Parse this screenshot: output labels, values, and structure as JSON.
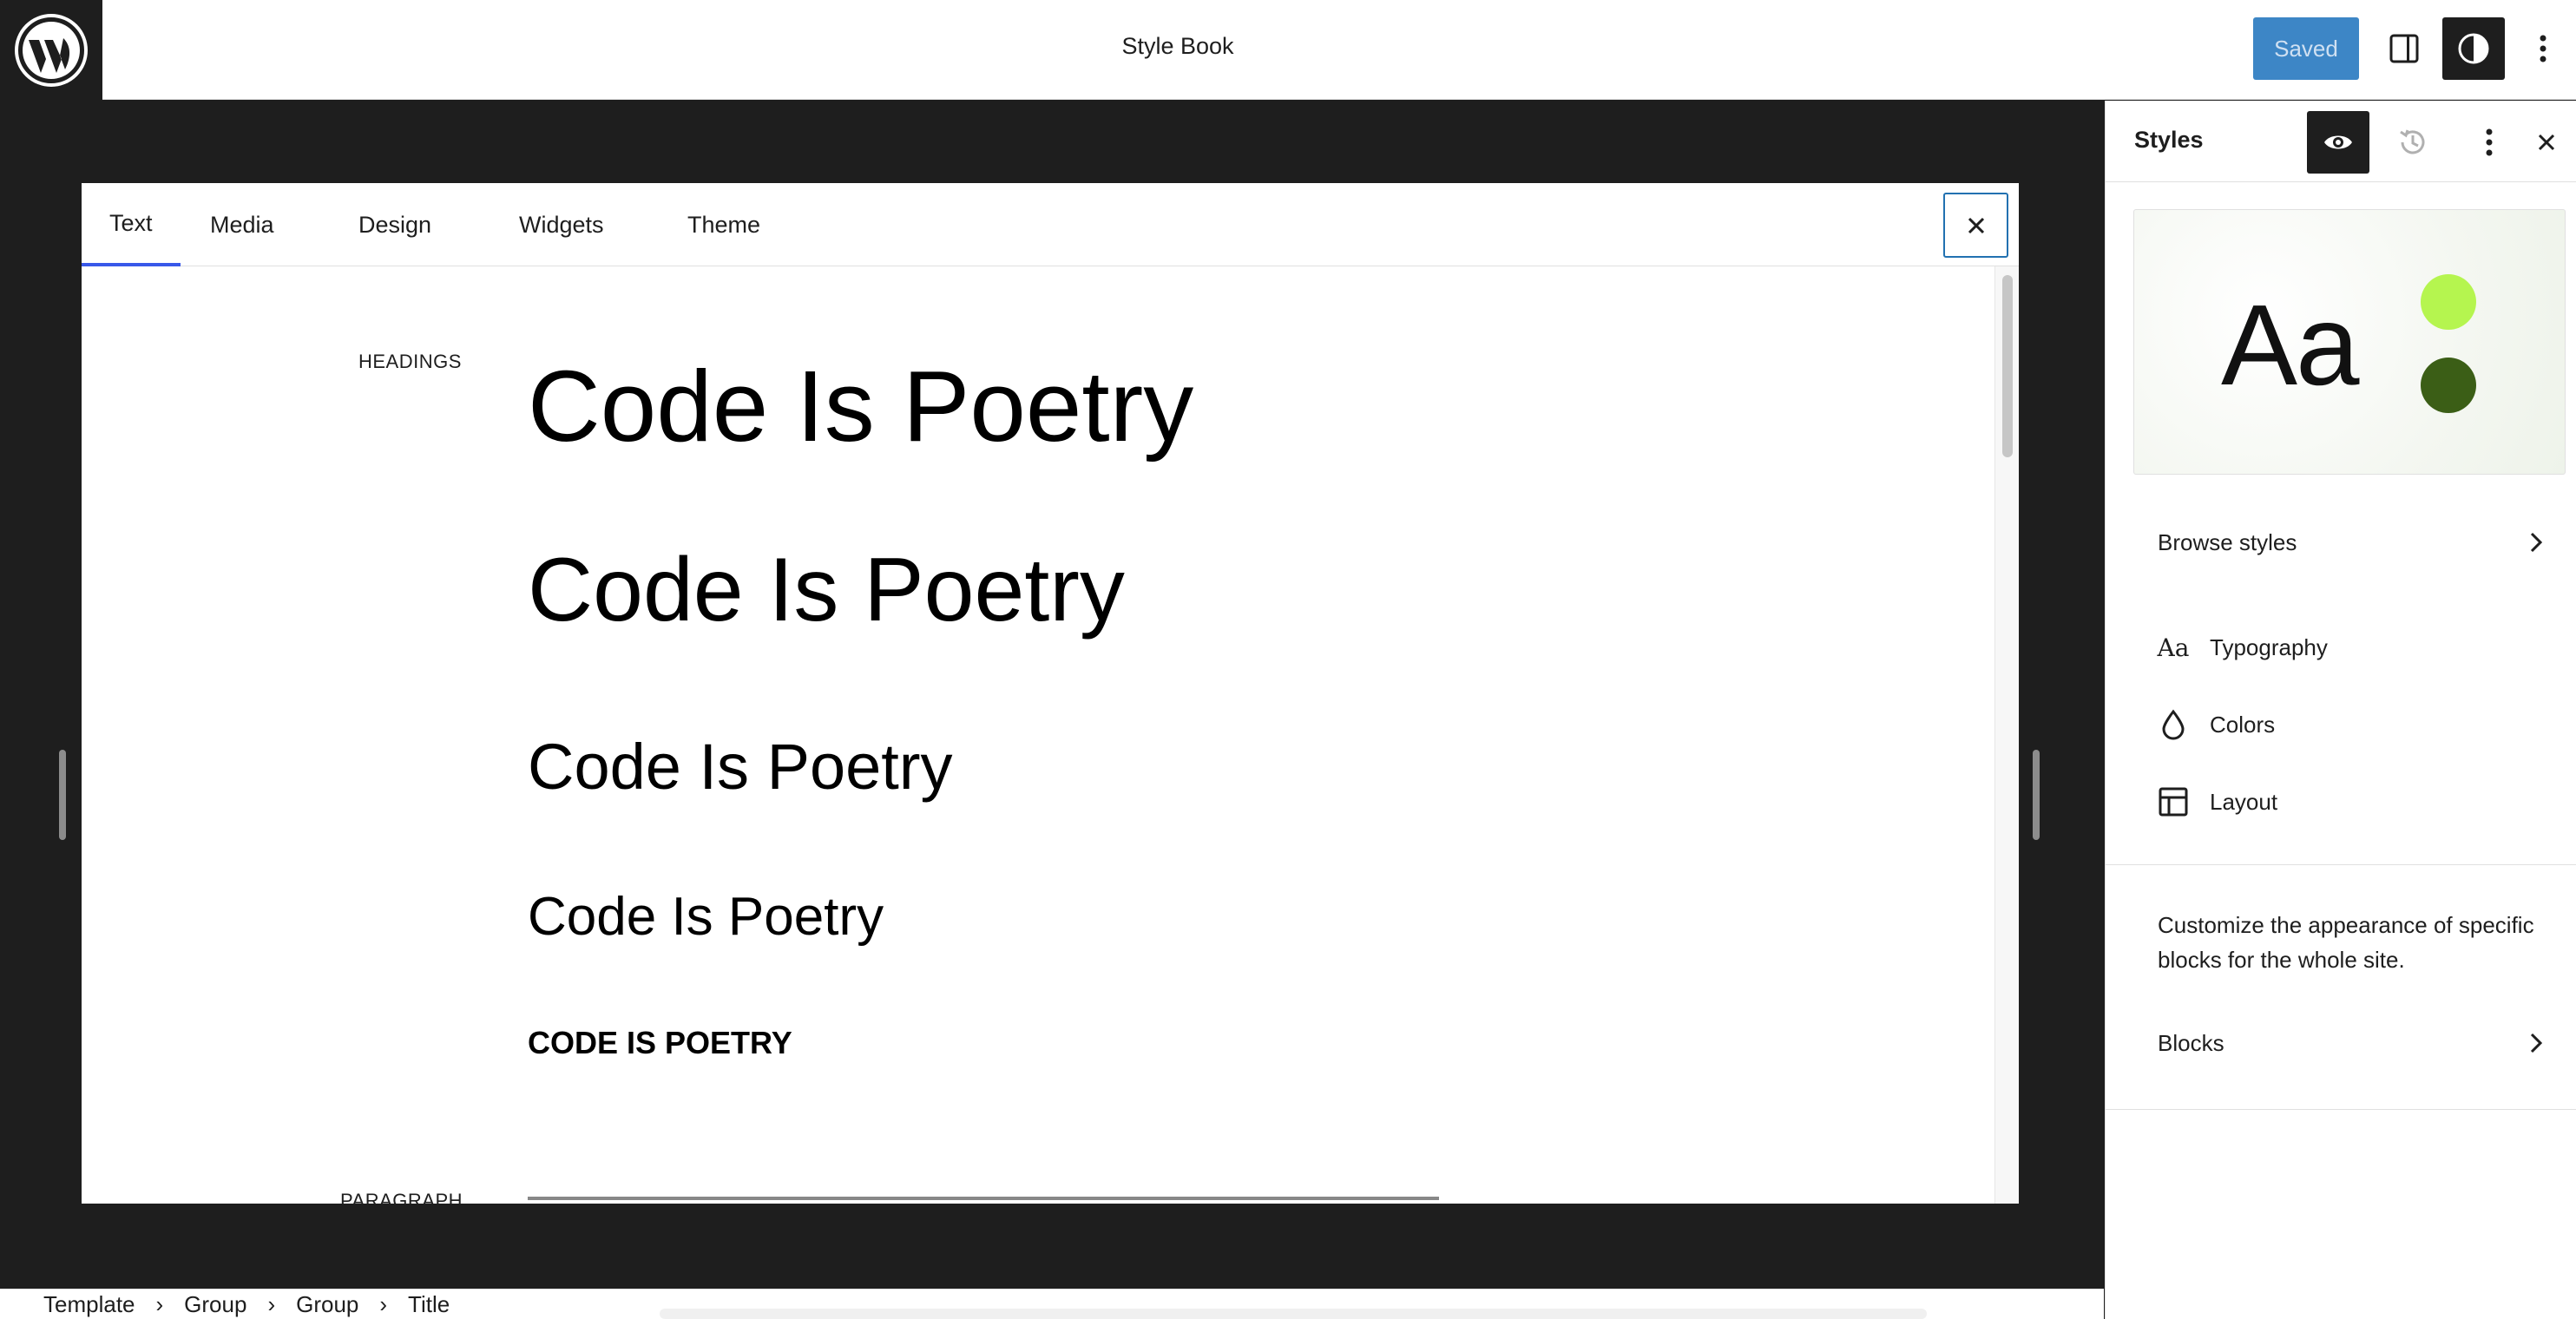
{
  "header": {
    "document_title": "Style Book",
    "saved_label": "Saved",
    "icons": [
      "wordpress-logo",
      "sidebar-toggle-icon",
      "styles-contrast-icon",
      "more-vertical-icon"
    ]
  },
  "stylebook": {
    "tabs": [
      {
        "label": "Text",
        "active": true
      },
      {
        "label": "Media",
        "active": false
      },
      {
        "label": "Design",
        "active": false
      },
      {
        "label": "Widgets",
        "active": false
      },
      {
        "label": "Theme",
        "active": false
      }
    ],
    "sections": {
      "headings_label": "HEADINGS",
      "paragraph_label": "PARAGRAPH"
    },
    "headings": [
      "Code Is Poetry",
      "Code Is Poetry",
      "Code Is Poetry",
      "Code Is Poetry",
      "Code Is Poetry"
    ]
  },
  "breadcrumb": [
    "Template",
    "Group",
    "Group",
    "Title"
  ],
  "sidebar": {
    "title": "Styles",
    "preview": {
      "sample_text": "Aa",
      "colors": [
        "#b5f54f",
        "#3b5e16"
      ]
    },
    "browse_styles_label": "Browse styles",
    "nav_items": [
      {
        "label": "Typography",
        "icon": "typography-icon"
      },
      {
        "label": "Colors",
        "icon": "droplet-icon"
      },
      {
        "label": "Layout",
        "icon": "layout-icon"
      }
    ],
    "description": "Customize the appearance of specific blocks for the whole site.",
    "blocks_label": "Blocks"
  },
  "colors": {
    "accent": "#3858e9",
    "saved_button": "#3d86c6",
    "dark": "#1e1e1e"
  }
}
